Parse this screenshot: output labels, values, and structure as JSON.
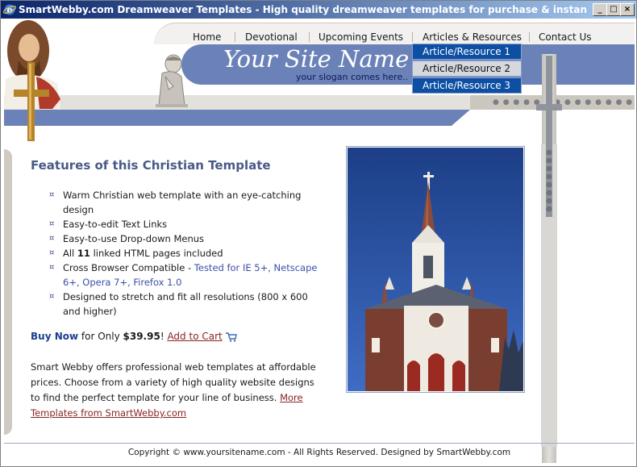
{
  "window": {
    "title": "SmartWebby.com Dreamweaver Templates - High quality dreamweaver templates for purchase & instan - Windows Interne..."
  },
  "nav": {
    "items": [
      "Home",
      "Devotional",
      "Upcoming Events",
      "Articles & Resources",
      "Contact Us"
    ],
    "dropdown": [
      "Article/Resource 1",
      "Article/Resource 2",
      "Article/Resource 3"
    ]
  },
  "header": {
    "site_name": "Your Site Name",
    "slogan": "your slogan comes here.."
  },
  "main": {
    "title": "Features of this Christian Template",
    "features": [
      {
        "text": "Warm Christian web template with an eye-catching design"
      },
      {
        "text": "Easy-to-edit Text Links"
      },
      {
        "text": "Easy-to-use Drop-down Menus"
      },
      {
        "pre": "All ",
        "bold": "11",
        "post": " linked HTML pages included"
      },
      {
        "pre": "Cross Browser Compatible - ",
        "link": "Tested for IE 5+, Netscape 6+, Opera 7+, Firefox 1.0"
      },
      {
        "text": "Designed to stretch and fit all resolutions (800 x 600 and higher)"
      }
    ],
    "buy": {
      "buy_now": "Buy Now",
      "for_only": " for Only ",
      "price": "$39.95",
      "exclaim": "! ",
      "add_to_cart": "Add to Cart"
    },
    "paragraph": "Smart Webby offers professional web templates at affordable prices. Choose from a variety of high quality website designs to find the perfect template for your line of business. ",
    "more_link": "More Templates from SmartWebby.com"
  },
  "footer": {
    "text": "Copyright © www.yoursitename.com - All Rights Reserved. Designed by SmartWebby.com"
  },
  "colors": {
    "accent_blue": "#6b82b8",
    "title_blue": "#4a5a86",
    "link_red": "#8b2323",
    "dropdown_blue": "#0c4fa3"
  }
}
